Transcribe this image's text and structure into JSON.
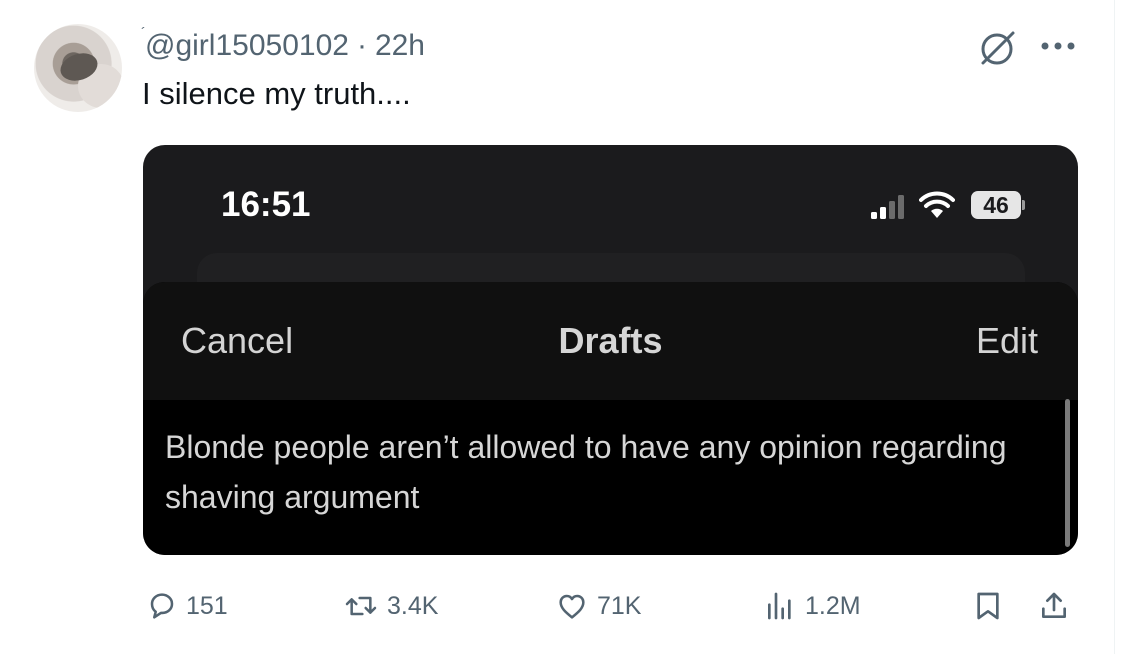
{
  "tweet": {
    "handle": "@girl15050102",
    "separator": "·",
    "time": "22h",
    "text": "I silence my truth...."
  },
  "screenshot": {
    "status_time": "16:51",
    "battery": "46",
    "header": {
      "cancel": "Cancel",
      "title": "Drafts",
      "edit": "Edit"
    },
    "draft_text": "Blonde people aren’t allowed to have any opinion regarding shaving argument"
  },
  "actions": {
    "replies": "151",
    "reposts": "3.4K",
    "likes": "71K",
    "views": "1.2M"
  },
  "icons": {
    "mute": "mute-icon",
    "more": "more-icon",
    "reply": "reply-icon",
    "repost": "repost-icon",
    "like": "heart-icon",
    "views": "views-icon",
    "bookmark": "bookmark-icon",
    "share": "share-icon"
  },
  "colors": {
    "text_primary": "#0f1419",
    "text_secondary": "#536471",
    "media_background": "#1b1b1d"
  }
}
